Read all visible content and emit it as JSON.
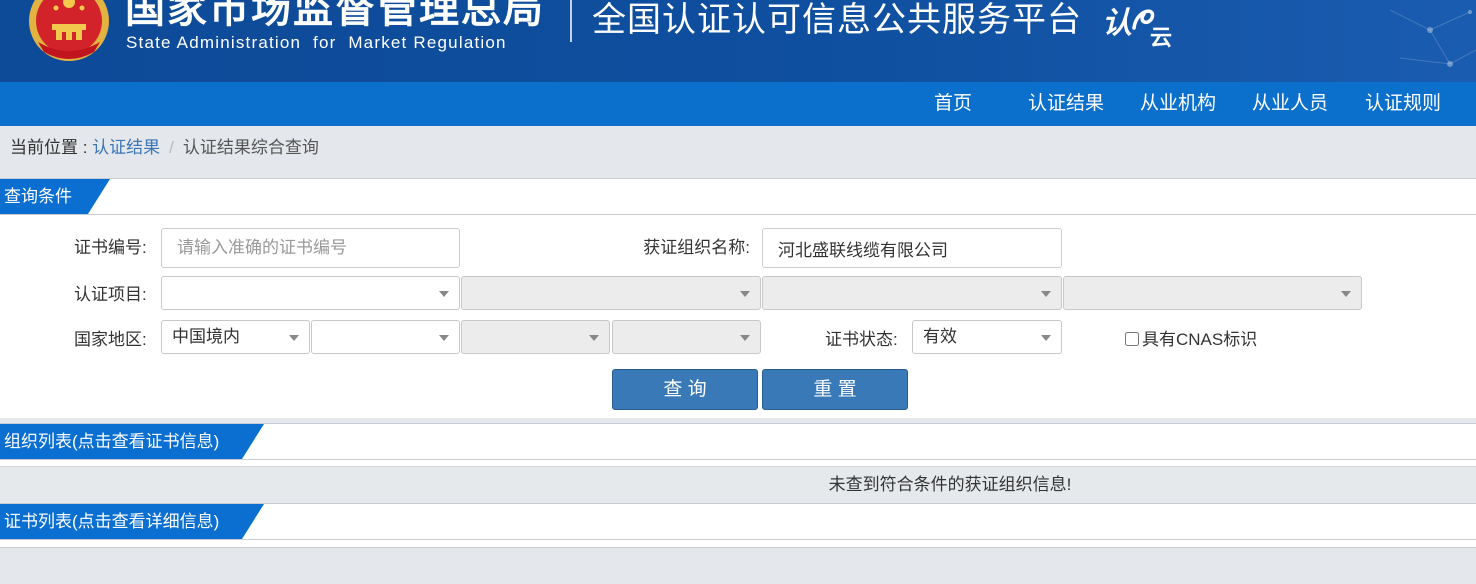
{
  "header": {
    "org_name_cn": "国家市场监督管理总局",
    "org_name_en": "State Administration  for  Market Regulation",
    "platform_title": "全国认证认可信息公共服务平台",
    "logo": {
      "char1": "认",
      "char2": "云"
    }
  },
  "nav": {
    "items": [
      {
        "label": "首页"
      },
      {
        "label": "认证结果"
      },
      {
        "label": "从业机构"
      },
      {
        "label": "从业人员"
      },
      {
        "label": "认证规则"
      }
    ]
  },
  "breadcrumb": {
    "prefix": "当前位置 : ",
    "link": "认证结果",
    "separator": "/",
    "current": "认证结果综合查询"
  },
  "query_section": {
    "title": "查询条件"
  },
  "form": {
    "cert_no": {
      "label": "证书编号:",
      "placeholder": "请输入准确的证书编号",
      "value": ""
    },
    "org_name": {
      "label": "获证组织名称:",
      "value": "河北盛联线缆有限公司"
    },
    "cert_project": {
      "label": "认证项目:"
    },
    "region": {
      "label": "国家地区:",
      "selected": "中国境内"
    },
    "cert_status": {
      "label": "证书状态:",
      "selected": "有效"
    },
    "cnas": {
      "label": "具有CNAS标识",
      "checked": false
    }
  },
  "buttons": {
    "query": "查 询",
    "reset": "重 置"
  },
  "org_list": {
    "title": "组织列表(点击查看证书信息)",
    "empty_message": "未查到符合条件的获证组织信息!"
  },
  "cert_list": {
    "title": "证书列表(点击查看详细信息)"
  },
  "colors": {
    "header_bg": "#0f4f9f",
    "nav_bg": "#0b6fcc",
    "tab_bg": "#0a6fd1",
    "button_bg": "#3a79b7",
    "link": "#3a76b8",
    "page_bg": "#e4e7eb"
  }
}
